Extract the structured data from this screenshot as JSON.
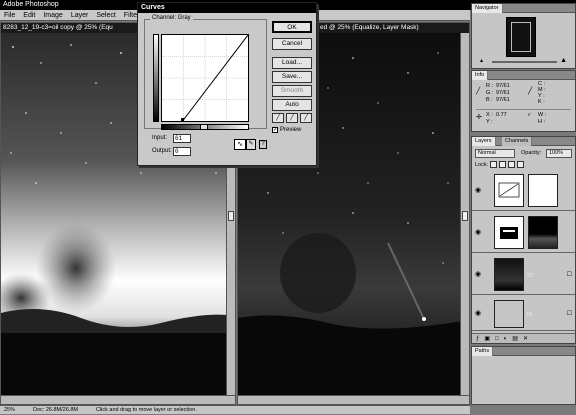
{
  "app": {
    "title": "Adobe Photoshop"
  },
  "menu": [
    "File",
    "Edit",
    "Image",
    "Layer",
    "Select",
    "Filter",
    "V"
  ],
  "doc_left": {
    "title": "8283_12_19-c3=oil copy @ 25% (Equ"
  },
  "doc_right": {
    "title": "ed @ 25% (Equalize, Layer Mask)"
  },
  "curves": {
    "title": "Curves",
    "channel_label": "Channel: Gray",
    "buttons": {
      "ok": "OK",
      "cancel": "Cancel",
      "load": "Load...",
      "save": "Save...",
      "smooth": "Smooth",
      "auto": "Auto"
    },
    "input_label": "Input:",
    "input_value": "61",
    "output_label": "Output:",
    "output_value": "0",
    "preview_label": "Preview",
    "preview_checked": true,
    "curve_points": [
      [
        61,
        0
      ],
      [
        255,
        255
      ]
    ]
  },
  "navigator": {
    "tab": "Navigator"
  },
  "info": {
    "tab": "Info",
    "rgb": {
      "r": "R :",
      "g": "G :",
      "b": "B :",
      "r_val": "97/61",
      "g_val": "97/61",
      "b_val": "97/61"
    },
    "cmyk": {
      "c": "C :",
      "m": "M :",
      "y": "Y :",
      "k": "K :"
    },
    "xy": {
      "x": "X :",
      "y": "Y :",
      "x_val": "0.77",
      "y_val": ""
    },
    "wh": {
      "w": "W :",
      "h": "H :"
    }
  },
  "layers": {
    "tabs": [
      "Layers",
      "Channels"
    ],
    "blend_mode": "Normal",
    "opacity_label": "Opacity:",
    "opacity_value": "100%",
    "lock_label": "Lock:",
    "rows": [
      {
        "name": "",
        "visible": true
      },
      {
        "name": "",
        "visible": true
      },
      {
        "name": "ST",
        "visible": true
      },
      {
        "name": "Fir",
        "visible": true
      }
    ]
  },
  "paths": {
    "tab": "Paths"
  },
  "status": {
    "zoom": "25%",
    "doc": "Doc: 26.8M/26.8M",
    "hint": "Click and drag to move layer or selection."
  }
}
